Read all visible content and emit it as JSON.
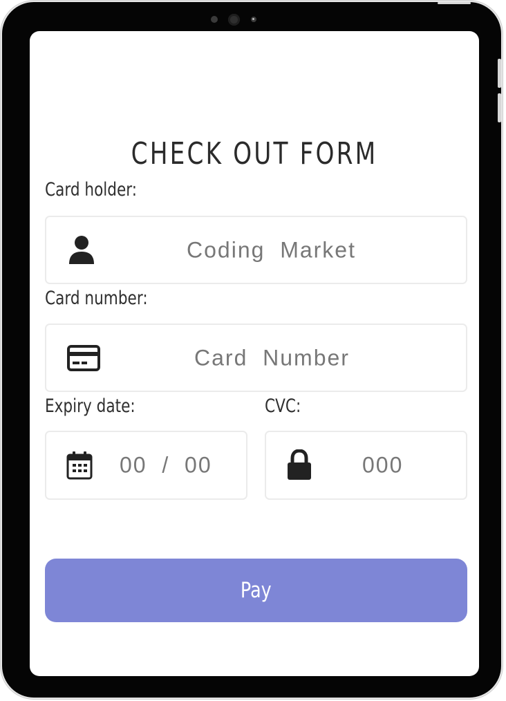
{
  "form": {
    "title": "CHECK OUT FORM",
    "card_holder": {
      "label": "Card holder:",
      "value": "Coding  Market",
      "icon": "user-icon"
    },
    "card_number": {
      "label": "Card number:",
      "placeholder": "Card  Number",
      "icon": "credit-card-icon"
    },
    "expiry": {
      "label": "Expiry date:",
      "placeholder": "00  /  00",
      "icon": "calendar-icon"
    },
    "cvc": {
      "label": "CVC:",
      "placeholder": "000",
      "icon": "lock-icon"
    },
    "pay_label": "Pay"
  },
  "colors": {
    "accent": "#7e86d6",
    "device_frame": "#050505",
    "field_border": "#ebebeb",
    "field_text": "#777777"
  }
}
